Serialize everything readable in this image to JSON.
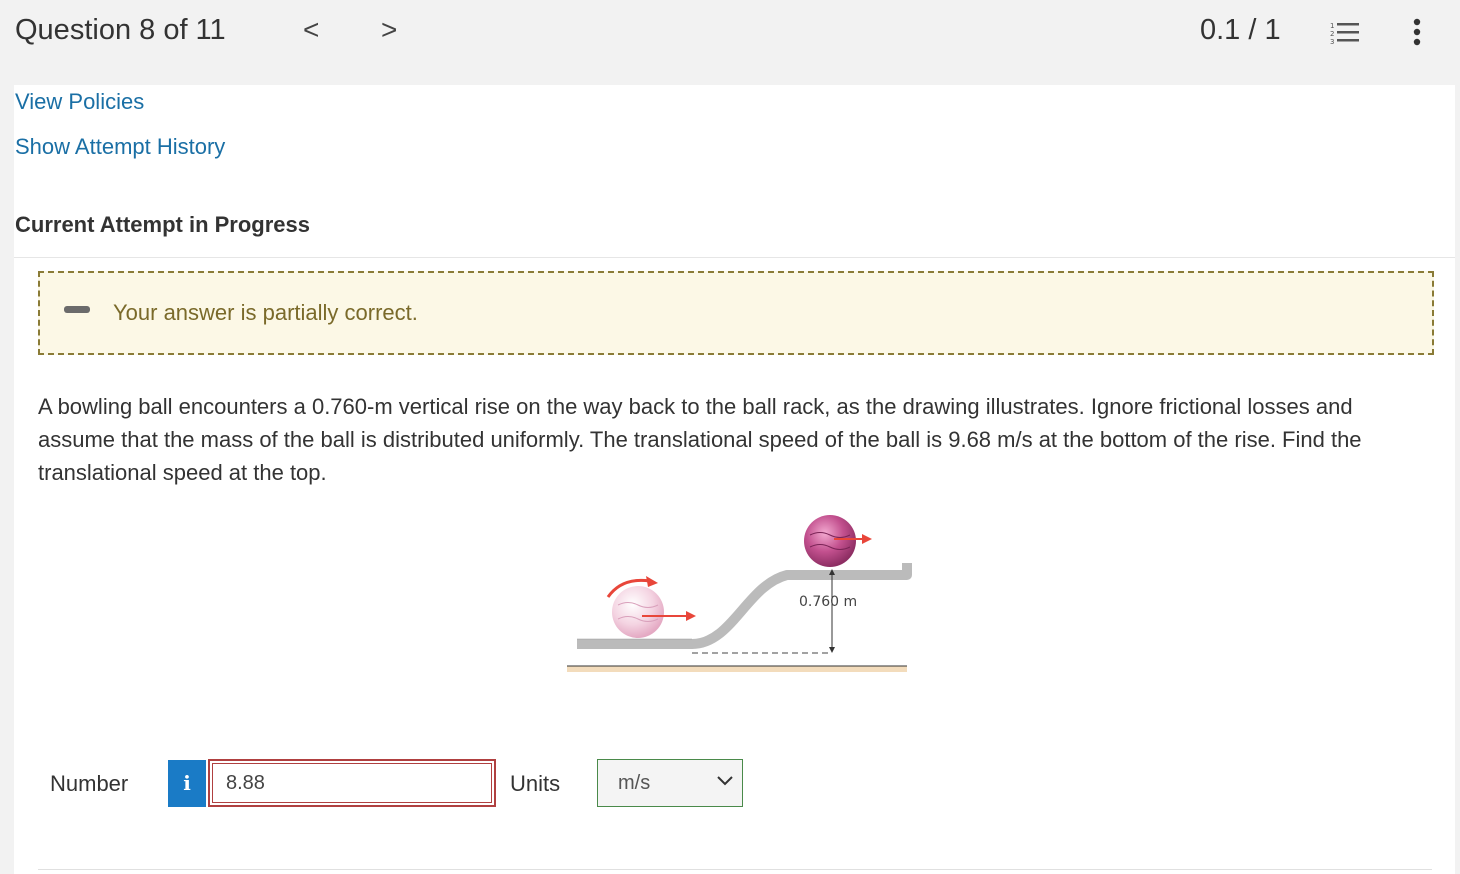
{
  "header": {
    "question_counter": "Question 8 of 11",
    "prev_symbol": "<",
    "next_symbol": ">",
    "score": "0.1 / 1"
  },
  "links": {
    "view_policies": "View Policies",
    "show_history": "Show Attempt History"
  },
  "attempt_heading": "Current Attempt in Progress",
  "feedback": {
    "text": "Your answer is partially correct."
  },
  "question_text": "A bowling ball encounters a 0.760-m vertical rise on the way back to the ball rack, as the drawing illustrates. Ignore frictional losses and assume that the mass of the ball is distributed uniformly. The translational speed of the ball is 9.68 m/s at the bottom of the rise. Find the translational speed at the top.",
  "figure": {
    "height_label": "0.760 m"
  },
  "answer": {
    "number_label": "Number",
    "info_symbol": "i",
    "number_value": "8.88",
    "units_label": "Units",
    "units_value": "m/s"
  },
  "icons": {
    "list": "numbered-list-icon",
    "more": "more-vertical-icon"
  },
  "colors": {
    "link": "#1a6fa5",
    "feedback_bg": "#fcf8e6",
    "info_button": "#1a7bc6",
    "error_border": "#b04040",
    "ball_top": "#c2508e",
    "ball_bottom": "#f0c8d8",
    "arrow": "#e8463a"
  }
}
